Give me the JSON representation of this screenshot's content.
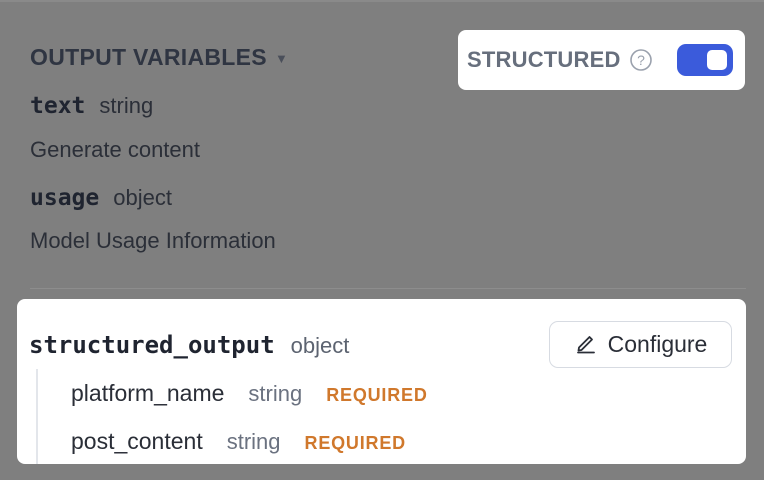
{
  "header": {
    "title": "OUTPUT VARIABLES",
    "structured_label": "STRUCTURED",
    "structured_enabled": true
  },
  "variables": [
    {
      "name": "text",
      "type": "string",
      "description": "Generate content"
    },
    {
      "name": "usage",
      "type": "object",
      "description": "Model Usage Information"
    }
  ],
  "structured_output": {
    "name": "structured_output",
    "type": "object",
    "configure_label": "Configure",
    "fields": [
      {
        "name": "platform_name",
        "type": "string",
        "required_label": "REQUIRED"
      },
      {
        "name": "post_content",
        "type": "string",
        "required_label": "REQUIRED"
      }
    ]
  },
  "colors": {
    "toggle_on": "#3b5bdb",
    "required": "#d0782c",
    "overlay": "#7f7f7f"
  },
  "icons": [
    "caret-down-icon",
    "help-circle-icon",
    "pencil-icon"
  ]
}
